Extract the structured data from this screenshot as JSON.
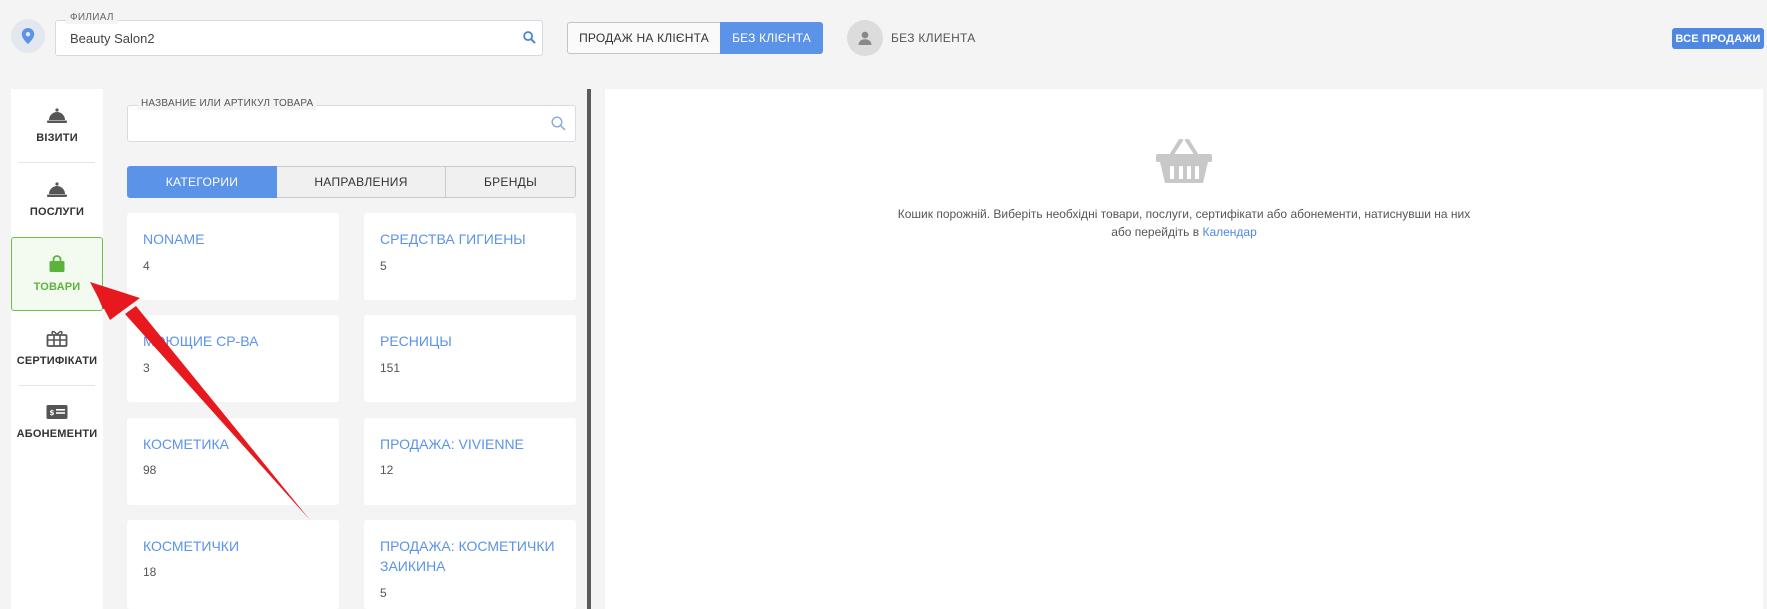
{
  "header": {
    "branch_label": "ФИЛИАЛ",
    "branch_value": "Beauty Salon2",
    "seg_client": "ПРОДАЖ НА КЛІЄНТА",
    "seg_noclient": "БЕЗ КЛІЄНТА",
    "client_name": "БЕЗ КЛИЕНТА",
    "all_sales": "ВСЕ ПРОДАЖИ"
  },
  "sidebar": {
    "items": [
      {
        "label": "ВІЗИТИ",
        "icon": "bell-icon"
      },
      {
        "label": "ПОСЛУГИ",
        "icon": "bell-icon"
      },
      {
        "label": "ТОВАРИ",
        "icon": "shopping-bag-icon",
        "active": true
      },
      {
        "label": "СЕРТИФІКАТИ",
        "icon": "gift-icon"
      },
      {
        "label": "АБОНЕМЕНТИ",
        "icon": "ticket-icon"
      }
    ]
  },
  "catalog": {
    "search_label": "НАЗВАНИЕ ИЛИ АРТИКУЛ ТОВАРА",
    "tabs": [
      "КАТЕГОРИИ",
      "НАПРАВЛЕНИЯ",
      "БРЕНДЫ"
    ],
    "categories": [
      {
        "name": "NONAME",
        "count": "4"
      },
      {
        "name": "СРЕДСТВА ГИГИЕНЫ",
        "count": "5"
      },
      {
        "name": "МОЮЩИЕ СР-ВА",
        "count": "3"
      },
      {
        "name": "РЕСНИЦЫ",
        "count": "151"
      },
      {
        "name": "КОСМЕТИКА",
        "count": "98"
      },
      {
        "name": "ПРОДАЖА: VIVIENNE",
        "count": "12"
      },
      {
        "name": "КОСМЕТИЧКИ",
        "count": "18"
      },
      {
        "name": "ПРОДАЖА: КОСМЕТИЧКИ ЗАИКИНА",
        "count": "5"
      }
    ]
  },
  "cart": {
    "empty_line1": "Кошик порожній. Виберіть необхідні товари, послуги, сертифікати або абонементи, натиснувши на них",
    "empty_line2": "або перейдіть в",
    "calendar_link": "Календар"
  },
  "colors": {
    "accent": "#5b93e8",
    "active_green": "#5cb33c",
    "arrow": "#e8191e"
  }
}
